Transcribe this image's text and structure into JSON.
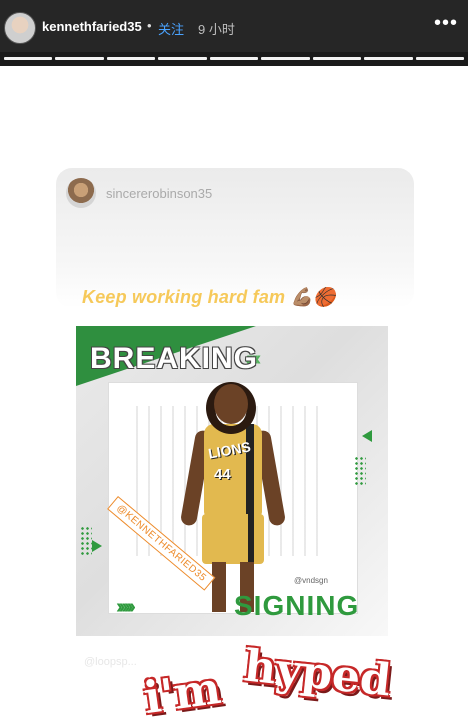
{
  "header": {
    "username": "kennethfaried35",
    "separator": "•",
    "follow_label": "关注",
    "time_ago": "9 小时",
    "more_icon": "more-horizontal-icon",
    "progress_segments": 9
  },
  "story": {
    "shared_card": {
      "username": "sincererobinson35"
    },
    "caption": "Keep working hard fam 💪🏽🏀",
    "poster": {
      "headline_top": "BREAKING",
      "headline_bottom": "SIGNING",
      "jersey_team": "LIONS",
      "jersey_number": "44",
      "player_tag": "@KENNETHFARIED35",
      "designer_handle": "@vndsgn",
      "accent_color": "#2f9a3e",
      "jersey_color": "#e2b94f"
    },
    "watermark": "@loopsp...",
    "sticker_text": "i'm hyped",
    "sticker_color": "#c62828"
  }
}
